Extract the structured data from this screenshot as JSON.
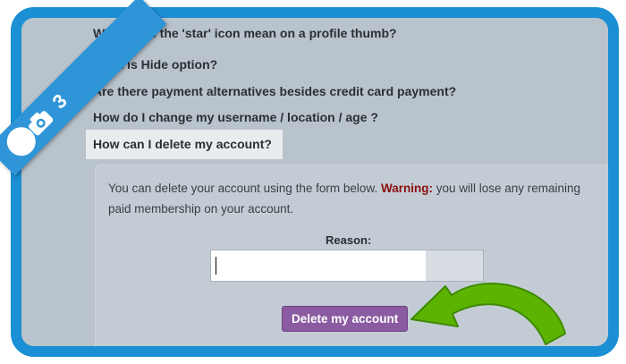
{
  "faq": {
    "q1": "What does the 'star' icon mean on a profile thumb?",
    "q2": "What is Hide option?",
    "q3": "Are there payment alternatives besides credit card payment?",
    "q4": "How do I change my username / location / age ?",
    "active": "How can I delete my account?"
  },
  "panel": {
    "message_before": "You can delete your account using the form below. ",
    "warning_label": "Warning:",
    "message_after": " you will lose any remaining paid membership on your account.",
    "reason_label": "Reason:",
    "reason_value": "",
    "delete_button": "Delete my account"
  },
  "badge": {
    "step_number": "3",
    "icon": "camera-icon"
  },
  "colors": {
    "frame": "#1b8fd3",
    "button": "#8a5ba0",
    "warning": "#8b1010",
    "arrow": "#5cb400"
  }
}
